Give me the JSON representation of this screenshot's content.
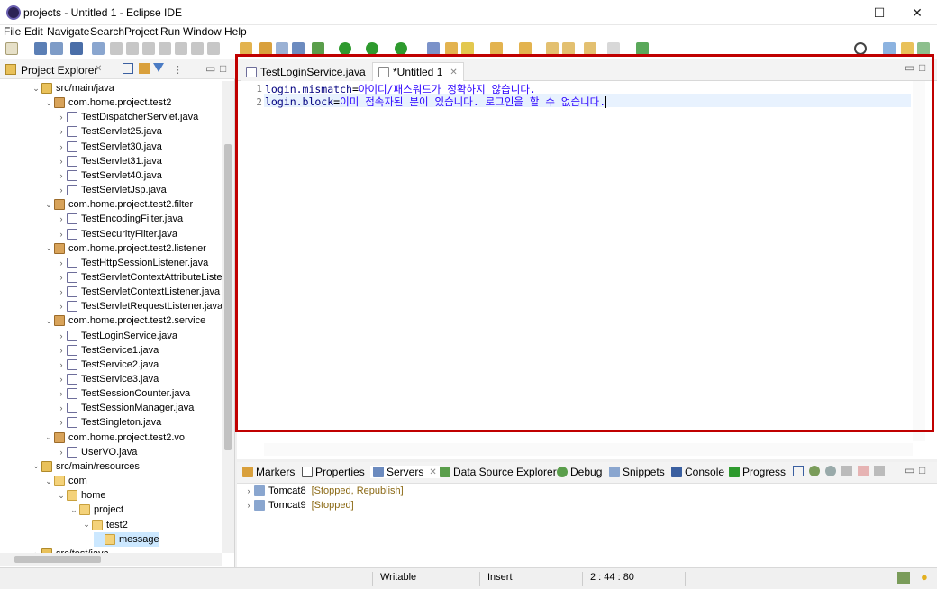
{
  "window": {
    "title": "projects - Untitled 1 - Eclipse IDE",
    "min": "—",
    "max": "☐",
    "close": "✕"
  },
  "menu": [
    "File",
    "Edit",
    "Navigate",
    "Search",
    "Project",
    "Run",
    "Window",
    "Help"
  ],
  "explorer": {
    "title": "Project Explorer",
    "close": "✕",
    "tree": [
      {
        "label": "src/main/java",
        "icon": "source-folder-icon",
        "open": true
      },
      {
        "label": "com.home.project.test2",
        "icon": "package-icon",
        "open": true
      },
      {
        "label": "TestDispatcherServlet.java",
        "icon": "java-file-icon"
      },
      {
        "label": "TestServlet25.java",
        "icon": "java-file-icon"
      },
      {
        "label": "TestServlet30.java",
        "icon": "java-file-icon"
      },
      {
        "label": "TestServlet31.java",
        "icon": "java-file-icon"
      },
      {
        "label": "TestServlet40.java",
        "icon": "java-file-icon"
      },
      {
        "label": "TestServletJsp.java",
        "icon": "java-file-icon"
      },
      {
        "label": "com.home.project.test2.filter",
        "icon": "package-icon",
        "open": true
      },
      {
        "label": "TestEncodingFilter.java",
        "icon": "java-file-icon"
      },
      {
        "label": "TestSecurityFilter.java",
        "icon": "java-file-icon"
      },
      {
        "label": "com.home.project.test2.listener",
        "icon": "package-icon",
        "open": true
      },
      {
        "label": "TestHttpSessionListener.java",
        "icon": "java-file-icon"
      },
      {
        "label": "TestServletContextAttributeListe",
        "icon": "java-file-icon"
      },
      {
        "label": "TestServletContextListener.java",
        "icon": "java-file-icon"
      },
      {
        "label": "TestServletRequestListener.java",
        "icon": "java-file-icon"
      },
      {
        "label": "com.home.project.test2.service",
        "icon": "package-icon",
        "open": true
      },
      {
        "label": "TestLoginService.java",
        "icon": "java-file-icon"
      },
      {
        "label": "TestService1.java",
        "icon": "java-file-icon"
      },
      {
        "label": "TestService2.java",
        "icon": "java-file-icon"
      },
      {
        "label": "TestService3.java",
        "icon": "java-file-icon"
      },
      {
        "label": "TestSessionCounter.java",
        "icon": "java-file-icon"
      },
      {
        "label": "TestSessionManager.java",
        "icon": "java-file-icon"
      },
      {
        "label": "TestSingleton.java",
        "icon": "java-file-icon"
      },
      {
        "label": "com.home.project.test2.vo",
        "icon": "package-icon",
        "open": true
      },
      {
        "label": "UserVO.java",
        "icon": "java-file-icon"
      },
      {
        "label": "src/main/resources",
        "icon": "source-folder-icon",
        "open": true
      },
      {
        "label": "com",
        "icon": "folder-icon",
        "open": true
      },
      {
        "label": "home",
        "icon": "folder-icon",
        "open": true
      },
      {
        "label": "project",
        "icon": "folder-icon",
        "open": true
      },
      {
        "label": "test2",
        "icon": "folder-icon",
        "open": true
      },
      {
        "label": "message",
        "icon": "folder-icon",
        "selected": true
      },
      {
        "label": "src/test/java",
        "icon": "source-folder-icon"
      }
    ]
  },
  "editor": {
    "tabs": [
      {
        "label": "TestLoginService.java",
        "active": false
      },
      {
        "label": "*Untitled 1",
        "active": true,
        "close": "✕"
      }
    ],
    "lines": [
      {
        "num": "1",
        "key": "login.mismatch",
        "eq": "=",
        "value": "아이디/패스워드가 정확하지 않습니다."
      },
      {
        "num": "2",
        "key": "login.block",
        "eq": "=",
        "value": "이미 접속자된 분이 있습니다. 로그인을 할 수 없습니다."
      }
    ]
  },
  "bottom": {
    "tabs": [
      "Markers",
      "Properties",
      "Servers",
      "Data Source Explorer",
      "Debug",
      "Snippets",
      "Console",
      "Progress"
    ],
    "servers": [
      {
        "name": "Tomcat8",
        "status": "[Stopped, Republish]"
      },
      {
        "name": "Tomcat9",
        "status": "[Stopped]"
      }
    ]
  },
  "status": {
    "writable": "Writable",
    "insert": "Insert",
    "position": "2 : 44 : 80"
  },
  "colors": {
    "highlight": "#c00000",
    "server_status": "#8b6914"
  }
}
